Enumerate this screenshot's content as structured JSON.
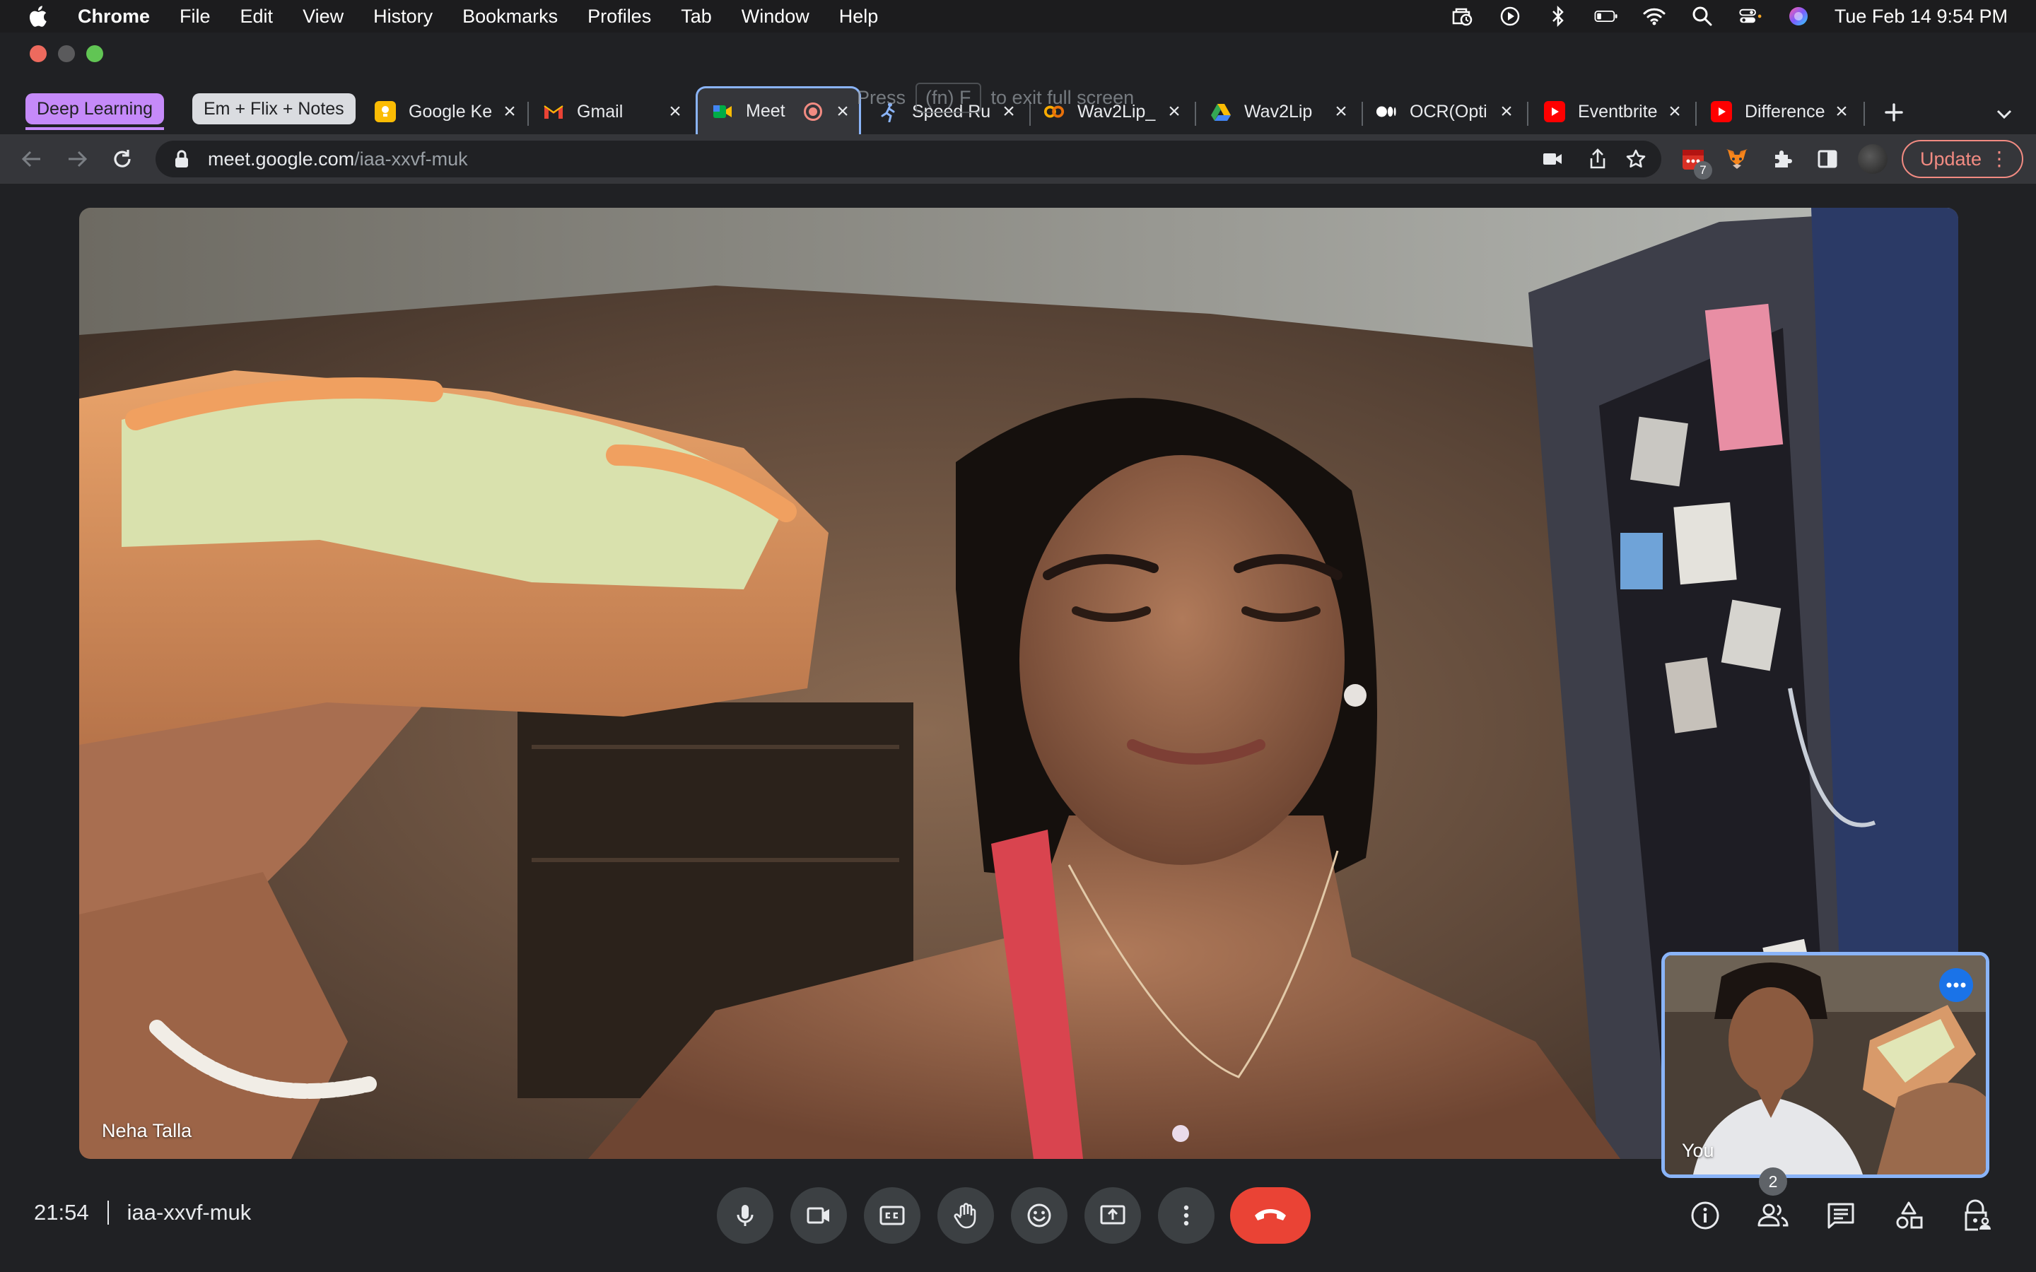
{
  "menubar": {
    "app": "Chrome",
    "items": [
      "File",
      "Edit",
      "View",
      "History",
      "Bookmarks",
      "Profiles",
      "Tab",
      "Window",
      "Help"
    ],
    "clock": "Tue Feb 14  9:54 PM"
  },
  "tab_groups": [
    {
      "label": "Deep Learning",
      "color": "#c58af9"
    },
    {
      "label": "Em + Flix + Notes",
      "color": "#dadce0"
    }
  ],
  "tabs": [
    {
      "label": "Google Ke",
      "favicon": "google-keep-icon",
      "color": "#fbbc04"
    },
    {
      "label": "Gmail",
      "favicon": "gmail-icon",
      "color": "#ea4335"
    },
    {
      "label": "Meet",
      "favicon": "meet-icon",
      "color": "#00ac47",
      "active": true
    },
    {
      "label": "Speed Ru",
      "favicon": "runner-icon",
      "color": "#8ab4f8"
    },
    {
      "label": "Wav2Lip_",
      "favicon": "colab-icon",
      "color": "#f9ab00"
    },
    {
      "label": "Wav2Lip",
      "favicon": "drive-icon",
      "color": "#34a853"
    },
    {
      "label": "OCR(Opti",
      "favicon": "medium-icon",
      "color": "#ffffff"
    },
    {
      "label": "Eventbrite",
      "favicon": "youtube-icon",
      "color": "#ff0000"
    },
    {
      "label": "Difference",
      "favicon": "youtube-icon",
      "color": "#ff0000"
    }
  ],
  "fullscreen_hint": {
    "before": "Press",
    "key": "(fn) F",
    "after": "to exit full screen"
  },
  "address_bar": {
    "host": "meet.google.com",
    "path": "/iaa-xxvf-muk"
  },
  "extensions": {
    "calendar_badge": "7"
  },
  "update_button": "Update",
  "meeting": {
    "main_participant": "Neha Talla",
    "self_label": "You",
    "time": "21:54",
    "code": "iaa-xxvf-muk",
    "participant_count": "2"
  },
  "colors": {
    "accent": "#8ab4f8",
    "leave": "#ea4335",
    "control_bg": "#3c4043"
  }
}
